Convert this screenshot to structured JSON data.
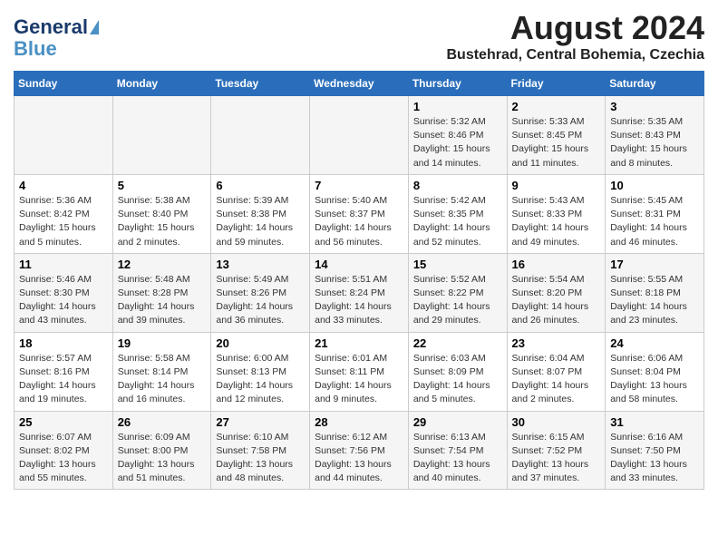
{
  "header": {
    "logo_line1": "General",
    "logo_line2": "Blue",
    "month_title": "August 2024",
    "subtitle": "Bustehrad, Central Bohemia, Czechia"
  },
  "weekdays": [
    "Sunday",
    "Monday",
    "Tuesday",
    "Wednesday",
    "Thursday",
    "Friday",
    "Saturday"
  ],
  "weeks": [
    [
      {
        "day": "",
        "info": ""
      },
      {
        "day": "",
        "info": ""
      },
      {
        "day": "",
        "info": ""
      },
      {
        "day": "",
        "info": ""
      },
      {
        "day": "1",
        "info": "Sunrise: 5:32 AM\nSunset: 8:46 PM\nDaylight: 15 hours\nand 14 minutes."
      },
      {
        "day": "2",
        "info": "Sunrise: 5:33 AM\nSunset: 8:45 PM\nDaylight: 15 hours\nand 11 minutes."
      },
      {
        "day": "3",
        "info": "Sunrise: 5:35 AM\nSunset: 8:43 PM\nDaylight: 15 hours\nand 8 minutes."
      }
    ],
    [
      {
        "day": "4",
        "info": "Sunrise: 5:36 AM\nSunset: 8:42 PM\nDaylight: 15 hours\nand 5 minutes."
      },
      {
        "day": "5",
        "info": "Sunrise: 5:38 AM\nSunset: 8:40 PM\nDaylight: 15 hours\nand 2 minutes."
      },
      {
        "day": "6",
        "info": "Sunrise: 5:39 AM\nSunset: 8:38 PM\nDaylight: 14 hours\nand 59 minutes."
      },
      {
        "day": "7",
        "info": "Sunrise: 5:40 AM\nSunset: 8:37 PM\nDaylight: 14 hours\nand 56 minutes."
      },
      {
        "day": "8",
        "info": "Sunrise: 5:42 AM\nSunset: 8:35 PM\nDaylight: 14 hours\nand 52 minutes."
      },
      {
        "day": "9",
        "info": "Sunrise: 5:43 AM\nSunset: 8:33 PM\nDaylight: 14 hours\nand 49 minutes."
      },
      {
        "day": "10",
        "info": "Sunrise: 5:45 AM\nSunset: 8:31 PM\nDaylight: 14 hours\nand 46 minutes."
      }
    ],
    [
      {
        "day": "11",
        "info": "Sunrise: 5:46 AM\nSunset: 8:30 PM\nDaylight: 14 hours\nand 43 minutes."
      },
      {
        "day": "12",
        "info": "Sunrise: 5:48 AM\nSunset: 8:28 PM\nDaylight: 14 hours\nand 39 minutes."
      },
      {
        "day": "13",
        "info": "Sunrise: 5:49 AM\nSunset: 8:26 PM\nDaylight: 14 hours\nand 36 minutes."
      },
      {
        "day": "14",
        "info": "Sunrise: 5:51 AM\nSunset: 8:24 PM\nDaylight: 14 hours\nand 33 minutes."
      },
      {
        "day": "15",
        "info": "Sunrise: 5:52 AM\nSunset: 8:22 PM\nDaylight: 14 hours\nand 29 minutes."
      },
      {
        "day": "16",
        "info": "Sunrise: 5:54 AM\nSunset: 8:20 PM\nDaylight: 14 hours\nand 26 minutes."
      },
      {
        "day": "17",
        "info": "Sunrise: 5:55 AM\nSunset: 8:18 PM\nDaylight: 14 hours\nand 23 minutes."
      }
    ],
    [
      {
        "day": "18",
        "info": "Sunrise: 5:57 AM\nSunset: 8:16 PM\nDaylight: 14 hours\nand 19 minutes."
      },
      {
        "day": "19",
        "info": "Sunrise: 5:58 AM\nSunset: 8:14 PM\nDaylight: 14 hours\nand 16 minutes."
      },
      {
        "day": "20",
        "info": "Sunrise: 6:00 AM\nSunset: 8:13 PM\nDaylight: 14 hours\nand 12 minutes."
      },
      {
        "day": "21",
        "info": "Sunrise: 6:01 AM\nSunset: 8:11 PM\nDaylight: 14 hours\nand 9 minutes."
      },
      {
        "day": "22",
        "info": "Sunrise: 6:03 AM\nSunset: 8:09 PM\nDaylight: 14 hours\nand 5 minutes."
      },
      {
        "day": "23",
        "info": "Sunrise: 6:04 AM\nSunset: 8:07 PM\nDaylight: 14 hours\nand 2 minutes."
      },
      {
        "day": "24",
        "info": "Sunrise: 6:06 AM\nSunset: 8:04 PM\nDaylight: 13 hours\nand 58 minutes."
      }
    ],
    [
      {
        "day": "25",
        "info": "Sunrise: 6:07 AM\nSunset: 8:02 PM\nDaylight: 13 hours\nand 55 minutes."
      },
      {
        "day": "26",
        "info": "Sunrise: 6:09 AM\nSunset: 8:00 PM\nDaylight: 13 hours\nand 51 minutes."
      },
      {
        "day": "27",
        "info": "Sunrise: 6:10 AM\nSunset: 7:58 PM\nDaylight: 13 hours\nand 48 minutes."
      },
      {
        "day": "28",
        "info": "Sunrise: 6:12 AM\nSunset: 7:56 PM\nDaylight: 13 hours\nand 44 minutes."
      },
      {
        "day": "29",
        "info": "Sunrise: 6:13 AM\nSunset: 7:54 PM\nDaylight: 13 hours\nand 40 minutes."
      },
      {
        "day": "30",
        "info": "Sunrise: 6:15 AM\nSunset: 7:52 PM\nDaylight: 13 hours\nand 37 minutes."
      },
      {
        "day": "31",
        "info": "Sunrise: 6:16 AM\nSunset: 7:50 PM\nDaylight: 13 hours\nand 33 minutes."
      }
    ]
  ]
}
